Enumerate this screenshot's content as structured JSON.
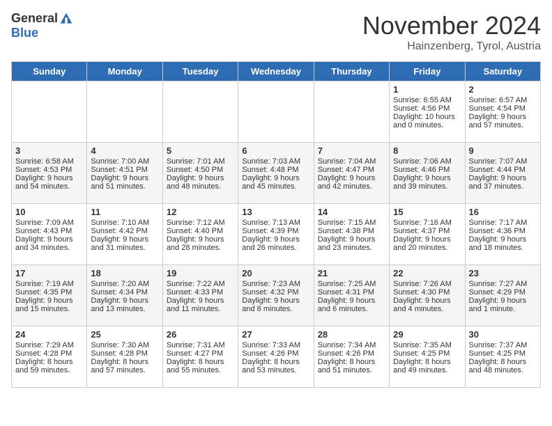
{
  "header": {
    "logo_general": "General",
    "logo_blue": "Blue",
    "month_title": "November 2024",
    "subtitle": "Hainzenberg, Tyrol, Austria"
  },
  "calendar": {
    "weekdays": [
      "Sunday",
      "Monday",
      "Tuesday",
      "Wednesday",
      "Thursday",
      "Friday",
      "Saturday"
    ],
    "weeks": [
      [
        {
          "day": "",
          "info": ""
        },
        {
          "day": "",
          "info": ""
        },
        {
          "day": "",
          "info": ""
        },
        {
          "day": "",
          "info": ""
        },
        {
          "day": "",
          "info": ""
        },
        {
          "day": "1",
          "info": "Sunrise: 6:55 AM\nSunset: 4:56 PM\nDaylight: 10 hours\nand 0 minutes."
        },
        {
          "day": "2",
          "info": "Sunrise: 6:57 AM\nSunset: 4:54 PM\nDaylight: 9 hours\nand 57 minutes."
        }
      ],
      [
        {
          "day": "3",
          "info": "Sunrise: 6:58 AM\nSunset: 4:53 PM\nDaylight: 9 hours\nand 54 minutes."
        },
        {
          "day": "4",
          "info": "Sunrise: 7:00 AM\nSunset: 4:51 PM\nDaylight: 9 hours\nand 51 minutes."
        },
        {
          "day": "5",
          "info": "Sunrise: 7:01 AM\nSunset: 4:50 PM\nDaylight: 9 hours\nand 48 minutes."
        },
        {
          "day": "6",
          "info": "Sunrise: 7:03 AM\nSunset: 4:48 PM\nDaylight: 9 hours\nand 45 minutes."
        },
        {
          "day": "7",
          "info": "Sunrise: 7:04 AM\nSunset: 4:47 PM\nDaylight: 9 hours\nand 42 minutes."
        },
        {
          "day": "8",
          "info": "Sunrise: 7:06 AM\nSunset: 4:46 PM\nDaylight: 9 hours\nand 39 minutes."
        },
        {
          "day": "9",
          "info": "Sunrise: 7:07 AM\nSunset: 4:44 PM\nDaylight: 9 hours\nand 37 minutes."
        }
      ],
      [
        {
          "day": "10",
          "info": "Sunrise: 7:09 AM\nSunset: 4:43 PM\nDaylight: 9 hours\nand 34 minutes."
        },
        {
          "day": "11",
          "info": "Sunrise: 7:10 AM\nSunset: 4:42 PM\nDaylight: 9 hours\nand 31 minutes."
        },
        {
          "day": "12",
          "info": "Sunrise: 7:12 AM\nSunset: 4:40 PM\nDaylight: 9 hours\nand 28 minutes."
        },
        {
          "day": "13",
          "info": "Sunrise: 7:13 AM\nSunset: 4:39 PM\nDaylight: 9 hours\nand 26 minutes."
        },
        {
          "day": "14",
          "info": "Sunrise: 7:15 AM\nSunset: 4:38 PM\nDaylight: 9 hours\nand 23 minutes."
        },
        {
          "day": "15",
          "info": "Sunrise: 7:16 AM\nSunset: 4:37 PM\nDaylight: 9 hours\nand 20 minutes."
        },
        {
          "day": "16",
          "info": "Sunrise: 7:17 AM\nSunset: 4:36 PM\nDaylight: 9 hours\nand 18 minutes."
        }
      ],
      [
        {
          "day": "17",
          "info": "Sunrise: 7:19 AM\nSunset: 4:35 PM\nDaylight: 9 hours\nand 15 minutes."
        },
        {
          "day": "18",
          "info": "Sunrise: 7:20 AM\nSunset: 4:34 PM\nDaylight: 9 hours\nand 13 minutes."
        },
        {
          "day": "19",
          "info": "Sunrise: 7:22 AM\nSunset: 4:33 PM\nDaylight: 9 hours\nand 11 minutes."
        },
        {
          "day": "20",
          "info": "Sunrise: 7:23 AM\nSunset: 4:32 PM\nDaylight: 9 hours\nand 8 minutes."
        },
        {
          "day": "21",
          "info": "Sunrise: 7:25 AM\nSunset: 4:31 PM\nDaylight: 9 hours\nand 6 minutes."
        },
        {
          "day": "22",
          "info": "Sunrise: 7:26 AM\nSunset: 4:30 PM\nDaylight: 9 hours\nand 4 minutes."
        },
        {
          "day": "23",
          "info": "Sunrise: 7:27 AM\nSunset: 4:29 PM\nDaylight: 9 hours\nand 1 minute."
        }
      ],
      [
        {
          "day": "24",
          "info": "Sunrise: 7:29 AM\nSunset: 4:28 PM\nDaylight: 8 hours\nand 59 minutes."
        },
        {
          "day": "25",
          "info": "Sunrise: 7:30 AM\nSunset: 4:28 PM\nDaylight: 8 hours\nand 57 minutes."
        },
        {
          "day": "26",
          "info": "Sunrise: 7:31 AM\nSunset: 4:27 PM\nDaylight: 8 hours\nand 55 minutes."
        },
        {
          "day": "27",
          "info": "Sunrise: 7:33 AM\nSunset: 4:26 PM\nDaylight: 8 hours\nand 53 minutes."
        },
        {
          "day": "28",
          "info": "Sunrise: 7:34 AM\nSunset: 4:26 PM\nDaylight: 8 hours\nand 51 minutes."
        },
        {
          "day": "29",
          "info": "Sunrise: 7:35 AM\nSunset: 4:25 PM\nDaylight: 8 hours\nand 49 minutes."
        },
        {
          "day": "30",
          "info": "Sunrise: 7:37 AM\nSunset: 4:25 PM\nDaylight: 8 hours\nand 48 minutes."
        }
      ]
    ]
  }
}
